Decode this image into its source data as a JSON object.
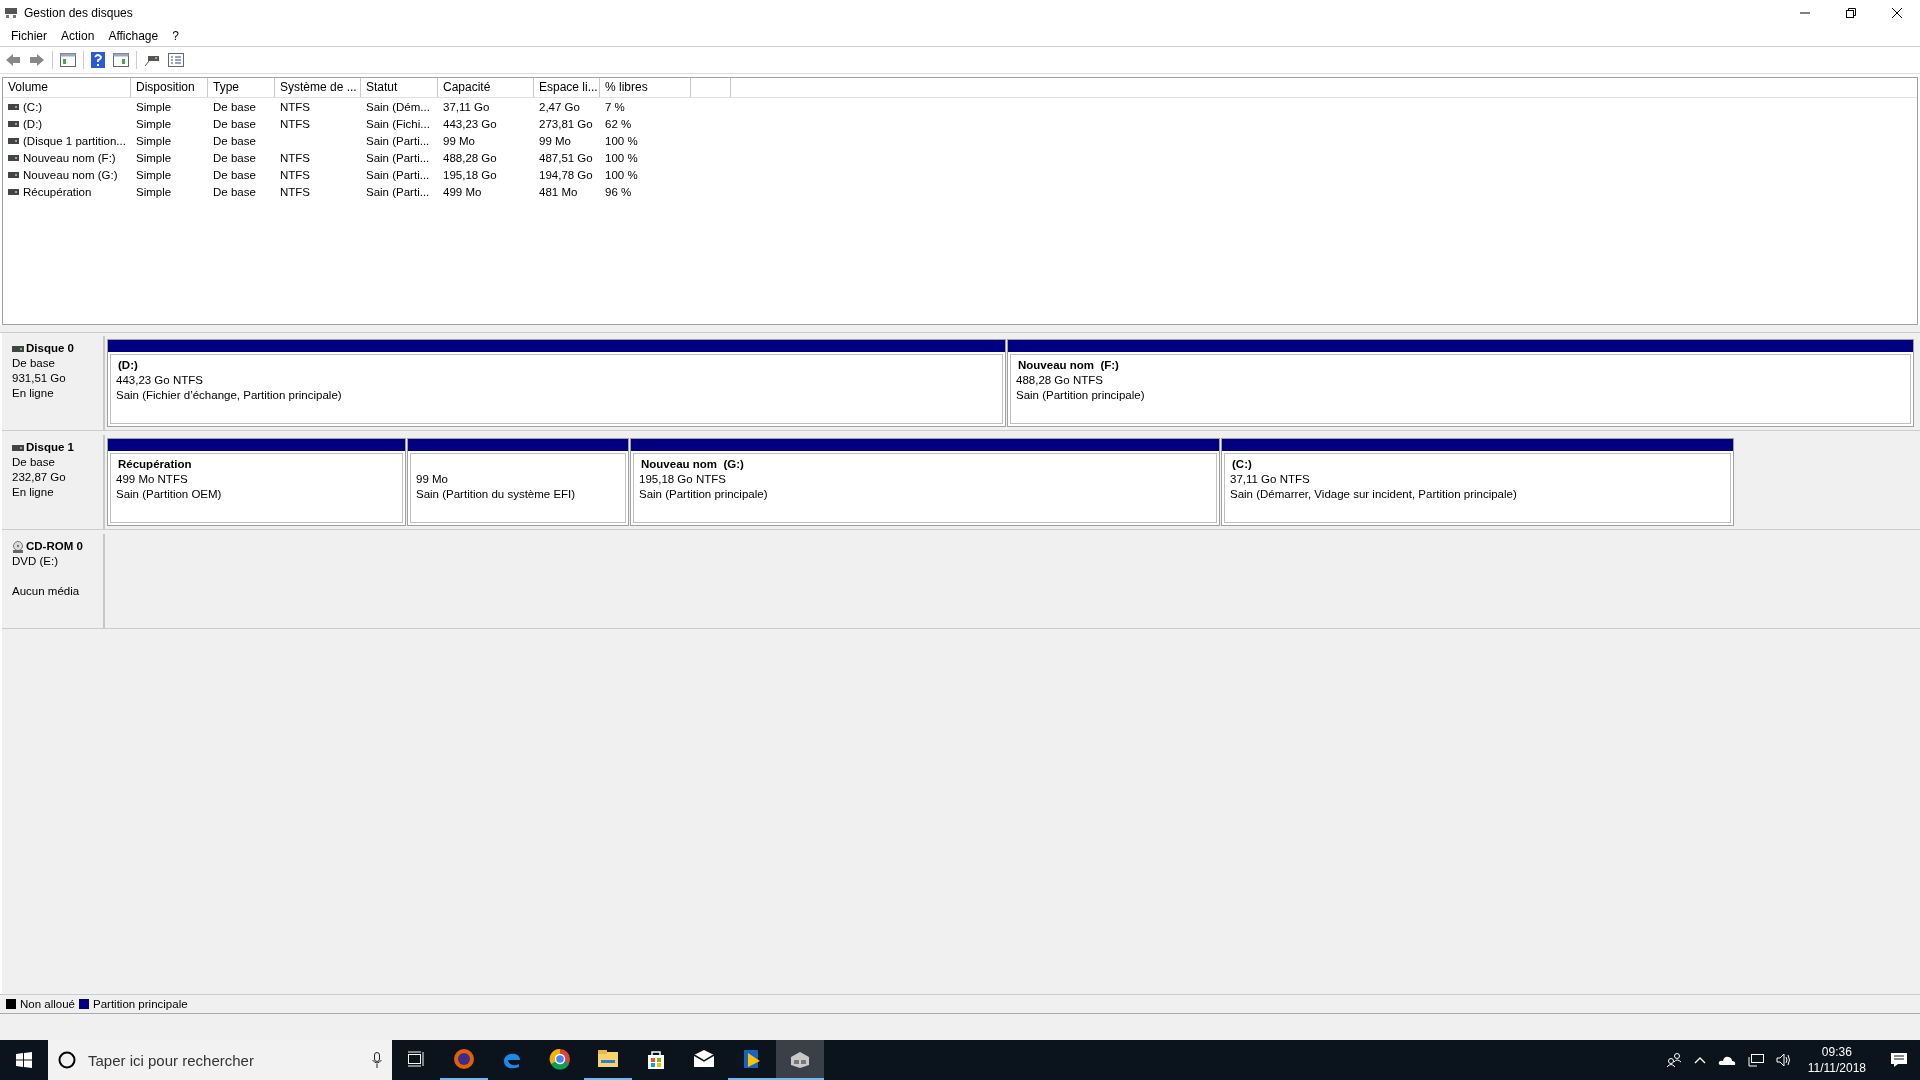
{
  "window": {
    "title": "Gestion des disques"
  },
  "menu": [
    "Fichier",
    "Action",
    "Affichage",
    "?"
  ],
  "table": {
    "columns": [
      "Volume",
      "Disposition",
      "Type",
      "Système de ...",
      "Statut",
      "Capacité",
      "Espace li...",
      "% libres"
    ],
    "rows": [
      [
        "(C:)",
        "Simple",
        "De base",
        "NTFS",
        "Sain (Dém...",
        "37,11 Go",
        "2,47 Go",
        "7 %"
      ],
      [
        "(D:)",
        "Simple",
        "De base",
        "NTFS",
        "Sain (Fichi...",
        "443,23 Go",
        "273,81 Go",
        "62 %"
      ],
      [
        "(Disque 1 partition...",
        "Simple",
        "De base",
        "",
        "Sain (Parti...",
        "99 Mo",
        "99 Mo",
        "100 %"
      ],
      [
        "Nouveau nom (F:)",
        "Simple",
        "De base",
        "NTFS",
        "Sain (Parti...",
        "488,28 Go",
        "487,51 Go",
        "100 %"
      ],
      [
        "Nouveau nom (G:)",
        "Simple",
        "De base",
        "NTFS",
        "Sain (Parti...",
        "195,18 Go",
        "194,78 Go",
        "100 %"
      ],
      [
        "Récupération",
        "Simple",
        "De base",
        "NTFS",
        "Sain (Parti...",
        "499 Mo",
        "481 Mo",
        "96 %"
      ]
    ]
  },
  "disks": [
    {
      "kind": "disk",
      "name": "Disque 0",
      "type": "De base",
      "size": "931,51 Go",
      "status": "En ligne",
      "partitions": [
        {
          "title": "(D:)",
          "size": "443,23 Go NTFS",
          "status": "Sain (Fichier d’échange, Partition principale)"
        },
        {
          "title": "Nouveau nom  (F:)",
          "size": "488,28 Go NTFS",
          "status": "Sain (Partition principale)"
        }
      ]
    },
    {
      "kind": "disk",
      "name": "Disque 1",
      "type": "De base",
      "size": "232,87 Go",
      "status": "En ligne",
      "partitions": [
        {
          "title": "Récupération",
          "size": "499 Mo NTFS",
          "status": "Sain (Partition OEM)"
        },
        {
          "size": "99 Mo",
          "status": "Sain (Partition du système EFI)"
        },
        {
          "title": "Nouveau nom  (G:)",
          "size": "195,18 Go NTFS",
          "status": "Sain (Partition principale)"
        },
        {
          "title": "(C:)",
          "size": "37,11 Go NTFS",
          "status": "Sain (Démarrer, Vidage sur incident, Partition principale)"
        }
      ]
    },
    {
      "kind": "cdrom",
      "name": "CD-ROM 0",
      "type": "DVD (E:)",
      "status": "Aucun média"
    }
  ],
  "legend": [
    {
      "label": "Non alloué",
      "color": "#000000"
    },
    {
      "label": "Partition principale",
      "color": "#000080"
    }
  ],
  "taskbar": {
    "search": {
      "placeholder": "Taper ici pour rechercher"
    },
    "apps": [
      {
        "running": true,
        "selected": false
      },
      {
        "running": false,
        "selected": false
      },
      {
        "running": false,
        "selected": false
      },
      {
        "running": true,
        "selected": false
      },
      {
        "running": false,
        "selected": false
      },
      {
        "running": false,
        "selected": false
      },
      {
        "running": true,
        "selected": false
      },
      {
        "running": true,
        "selected": true
      }
    ],
    "time": "09:36",
    "date": "11/11/2018"
  }
}
